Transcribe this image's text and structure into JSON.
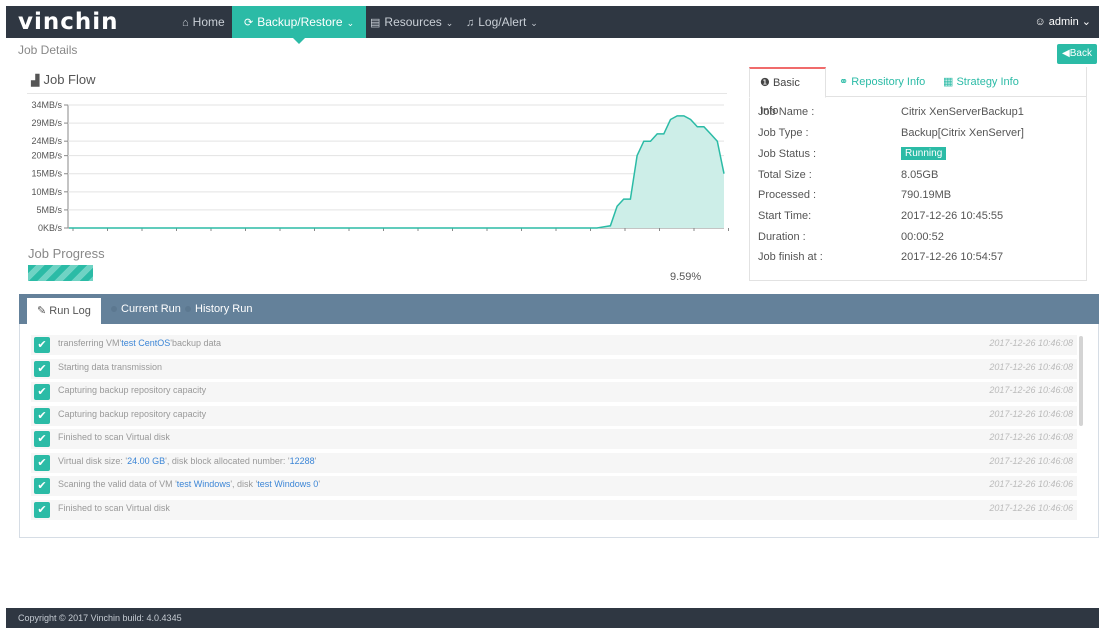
{
  "brand": {
    "logo": "vinchin",
    "accent": "#2bbba6",
    "nav_bg": "#2f3742",
    "tab_accent": "#f06b6b",
    "log_header_bg": "#64819a"
  },
  "nav": {
    "items": [
      {
        "label": "Home",
        "icon": "home-icon"
      },
      {
        "label": "Backup/Restore",
        "icon": "refresh-icon",
        "active": true
      },
      {
        "label": "Resources",
        "icon": "server-icon"
      },
      {
        "label": "Log/Alert",
        "icon": "bell-icon"
      }
    ],
    "user": "admin"
  },
  "page": {
    "title": "Job Details",
    "back_label": "Back"
  },
  "job_flow": {
    "title": "Job Flow",
    "progress_title": "Job Progress",
    "progress_value": 9.59,
    "progress_label": "9.59%"
  },
  "chart_data": {
    "type": "area",
    "title": "",
    "xlabel": "",
    "ylabel": "",
    "yticks": [
      "0KB/s",
      "5MB/s",
      "10MB/s",
      "15MB/s",
      "20MB/s",
      "24MB/s",
      "29MB/s",
      "34MB/s"
    ],
    "ylim": [
      0,
      34
    ],
    "grid": true,
    "series": [
      {
        "values": [
          0,
          0,
          0,
          0,
          0,
          0,
          0,
          0,
          0,
          0,
          0,
          0,
          0,
          0,
          0,
          0,
          0,
          0,
          0,
          0,
          0,
          0,
          0,
          0,
          0,
          0,
          0,
          0,
          0,
          0,
          0,
          0,
          0,
          0,
          0,
          0,
          0,
          0,
          0,
          0,
          0,
          0,
          0,
          0,
          0,
          0,
          0,
          0,
          0,
          0,
          0,
          0,
          0,
          0,
          0,
          0,
          0,
          0,
          0,
          0,
          0,
          0,
          0,
          0,
          0,
          0,
          0,
          0,
          0,
          0,
          0,
          0,
          0,
          0,
          0,
          0,
          0,
          0,
          0,
          0,
          0.3,
          0.6,
          6,
          8,
          8,
          20,
          24,
          24,
          26,
          26,
          30,
          31,
          31,
          30,
          28,
          28,
          26,
          24,
          15
        ]
      }
    ]
  },
  "basic_info": {
    "tabs": [
      {
        "label": "Basic Info",
        "icon": "info-icon"
      },
      {
        "label": "Repository Info",
        "icon": "share-icon"
      },
      {
        "label": "Strategy Info",
        "icon": "calendar-icon"
      }
    ],
    "rows": [
      {
        "label": "Job Name :",
        "value": "Citrix XenServerBackup1"
      },
      {
        "label": "Job Type :",
        "value": "Backup[Citrix XenServer]"
      },
      {
        "label": "Job Status :",
        "value": "Running"
      },
      {
        "label": "Total Size :",
        "value": "8.05GB"
      },
      {
        "label": "Processed :",
        "value": "790.19MB"
      },
      {
        "label": "Start Time:",
        "value": "2017-12-26 10:45:55"
      },
      {
        "label": "Duration :",
        "value": "00:00:52"
      },
      {
        "label": "Job finish at :",
        "value": "2017-12-26 10:54:57"
      }
    ]
  },
  "run_log": {
    "tabs": [
      "Run Log",
      "Current Run",
      "History Run"
    ],
    "entries": [
      {
        "pre": "transferring VM'",
        "hl": "test CentOS",
        "post": "'backup data",
        "time": "2017-12-26 10:46:08"
      },
      {
        "pre": "Starting data transmission",
        "hl": "",
        "post": "",
        "time": "2017-12-26 10:46:08"
      },
      {
        "pre": "Capturing backup repository capacity",
        "hl": "",
        "post": "",
        "time": "2017-12-26 10:46:08"
      },
      {
        "pre": "Capturing backup repository capacity",
        "hl": "",
        "post": "",
        "time": "2017-12-26 10:46:08"
      },
      {
        "pre": "Finished to scan Virtual disk",
        "hl": "",
        "post": "",
        "time": "2017-12-26 10:46:08"
      },
      {
        "pre": "Virtual disk size: '",
        "hl": "24.00 GB",
        "post": "', disk block allocated number: '",
        "hl2": "12288",
        "post2": "'",
        "time": "2017-12-26 10:46:08"
      },
      {
        "pre": "Scaning the valid data of VM '",
        "hl": "test Windows",
        "post": "', disk '",
        "hl2": "test Windows 0",
        "post2": "'",
        "time": "2017-12-26 10:46:06"
      },
      {
        "pre": "Finished to scan Virtual disk",
        "hl": "",
        "post": "",
        "time": "2017-12-26 10:46:06"
      }
    ]
  },
  "footer": {
    "text": "Copyright © 2017 Vinchin build: 4.0.4345"
  }
}
